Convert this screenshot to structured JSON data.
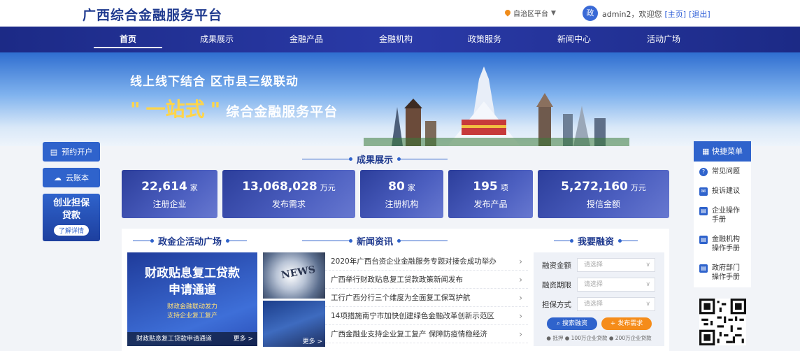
{
  "header": {
    "logo_text": "广西综合金融服务平台",
    "region_label": "自治区平台",
    "avatar_text": "政",
    "welcome_text": "admin2，欢迎您",
    "home_link": "[主页]",
    "logout_link": "[退出]"
  },
  "nav": {
    "items": [
      {
        "label": "首页",
        "active": true
      },
      {
        "label": "成果展示"
      },
      {
        "label": "金融产品"
      },
      {
        "label": "金融机构"
      },
      {
        "label": "政策服务"
      },
      {
        "label": "新闻中心"
      },
      {
        "label": "活动广场"
      }
    ]
  },
  "banner": {
    "subtitle": "线上线下结合   区市县三级联动",
    "quote_open": "\"",
    "highlight": "一站式",
    "quote_close": "\"",
    "title": "综合金融服务平台"
  },
  "left_sidebar": {
    "reserve_account": "预约开户",
    "cloud_account": "云账本",
    "loan_title_line1": "创业担保",
    "loan_title_line2": "贷款",
    "loan_more": "了解详情"
  },
  "achievements": {
    "title": "成果展示",
    "stats": [
      {
        "value": "22,614",
        "unit": "家",
        "label": "注册企业"
      },
      {
        "value": "13,068,028",
        "unit": "万元",
        "label": "发布需求"
      },
      {
        "value": "80",
        "unit": "家",
        "label": "注册机构"
      },
      {
        "value": "195",
        "unit": "项",
        "label": "发布产品"
      },
      {
        "value": "5,272,160",
        "unit": "万元",
        "label": "授信金额"
      }
    ]
  },
  "activity": {
    "section_title": "政金企活动广场",
    "card_title_line1": "财政贴息复工贷款",
    "card_title_line2": "申请通道",
    "card_slogan_line1": "财政金融联动发力",
    "card_slogan_line2": "支持企业复工复产",
    "caption": "财政贴息复工贷款申请通道",
    "more": "更多 >"
  },
  "news": {
    "section_title": "新闻资讯",
    "more": "更多 >",
    "items": [
      "2020年广西台资企业金融服务专题对接会成功举办",
      "广西举行财政贴息复工贷款政策新闻发布",
      "工行广西分行三个维度为全面复工保驾护航",
      "14项措施南宁市加快创建绿色金融改革创新示范区",
      "广西金融业支持企业复工复产 保障防疫情稳经济"
    ]
  },
  "financing": {
    "section_title": "我要融资",
    "amount_label": "融资金额",
    "term_label": "融资期限",
    "guarantee_label": "担保方式",
    "placeholder": "请选择",
    "search_btn": "搜索融资",
    "publish_btn": "发布需求",
    "footnote": "● 抵押  ● 100万企业贷款  ● 200万企业贷款"
  },
  "quick_menu": {
    "title": "快捷菜单",
    "items": [
      {
        "label": "常见问题",
        "icon": "question-icon"
      },
      {
        "label": "投诉建议",
        "icon": "mail-icon"
      },
      {
        "label": "企业操作手册",
        "icon": "document-icon"
      },
      {
        "label": "金融机构操作手册",
        "icon": "document-icon"
      },
      {
        "label": "政府部门操作手册",
        "icon": "document-icon"
      }
    ]
  },
  "colors": {
    "brand": "#1f3a8f",
    "accent": "#2f63cc",
    "orange": "#f58c1a",
    "nav_bg": "#1c2a86"
  }
}
